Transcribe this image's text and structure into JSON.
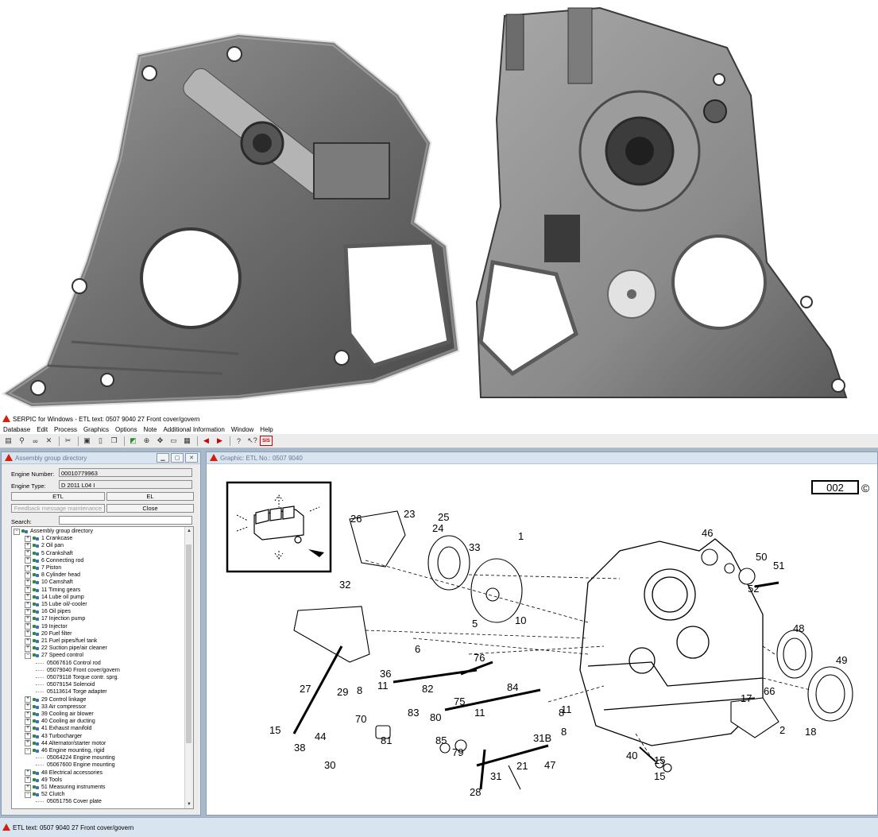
{
  "titlebar": {
    "text": "SERPIC for Windows - ETL text: 0507 9040    27   Front cover/govern"
  },
  "menu": [
    "Database",
    "Edit",
    "Process",
    "Graphics",
    "Options",
    "Note",
    "Additional Information",
    "Window",
    "Help"
  ],
  "toolbar": {
    "sis_label": "SIS"
  },
  "left_panel": {
    "title": "Assembly group directory",
    "engine_number_label": "Engine Number:",
    "engine_number": "00010779963",
    "engine_type_label": "Engine Type:",
    "engine_type": "D 2011 L04 I",
    "etl_button": "ETL",
    "el_button": "EL",
    "feedback_button": "Feedback message maintenance",
    "close_button": "Close",
    "search_label": "Search:",
    "tree": [
      {
        "text": "Assembly group directory",
        "level": 0,
        "type": "root"
      },
      {
        "text": "1  Crankcase",
        "level": 1,
        "type": "group"
      },
      {
        "text": "2  Oil pan",
        "level": 1,
        "type": "group"
      },
      {
        "text": "5  Crankshaft",
        "level": 1,
        "type": "group"
      },
      {
        "text": "6  Connecting rod",
        "level": 1,
        "type": "group"
      },
      {
        "text": "7  Piston",
        "level": 1,
        "type": "group"
      },
      {
        "text": "8  Cylinder head",
        "level": 1,
        "type": "group"
      },
      {
        "text": "10  Camshaft",
        "level": 1,
        "type": "group"
      },
      {
        "text": "11  Timing gears",
        "level": 1,
        "type": "group"
      },
      {
        "text": "14  Lube oil pump",
        "level": 1,
        "type": "group"
      },
      {
        "text": "15  Lube oil/-cooler",
        "level": 1,
        "type": "group"
      },
      {
        "text": "16  Oil pipes",
        "level": 1,
        "type": "group"
      },
      {
        "text": "17  Injection pump",
        "level": 1,
        "type": "group"
      },
      {
        "text": "19  Injector",
        "level": 1,
        "type": "group"
      },
      {
        "text": "20  Fuel filter",
        "level": 1,
        "type": "group"
      },
      {
        "text": "21  Fuel pipes/fuel tank",
        "level": 1,
        "type": "group"
      },
      {
        "text": "22  Suction pipe/air cleaner",
        "level": 1,
        "type": "group"
      },
      {
        "text": "27  Speed control",
        "level": 1,
        "type": "group-open"
      },
      {
        "text": "05067616  Control rod",
        "level": 2,
        "type": "leaf"
      },
      {
        "text": "05079040  Front cover/govern",
        "level": 2,
        "type": "leaf"
      },
      {
        "text": "05079118  Torque contr. sprg.",
        "level": 2,
        "type": "leaf"
      },
      {
        "text": "05079154  Solenoid",
        "level": 2,
        "type": "leaf"
      },
      {
        "text": "05113614  Torge adapter",
        "level": 2,
        "type": "leaf"
      },
      {
        "text": "29  Control linkage",
        "level": 1,
        "type": "group"
      },
      {
        "text": "33  Air compressor",
        "level": 1,
        "type": "group"
      },
      {
        "text": "39  Cooling air blower",
        "level": 1,
        "type": "group"
      },
      {
        "text": "40  Cooling air ducting",
        "level": 1,
        "type": "group"
      },
      {
        "text": "41  Exhaust manifold",
        "level": 1,
        "type": "group"
      },
      {
        "text": "43  Turbocharger",
        "level": 1,
        "type": "group"
      },
      {
        "text": "44  Alternator/starter motor",
        "level": 1,
        "type": "group"
      },
      {
        "text": "46  Engine mounting, rigid",
        "level": 1,
        "type": "group-open"
      },
      {
        "text": "05064224  Engine mounting",
        "level": 2,
        "type": "leaf"
      },
      {
        "text": "05067600  Engine mounting",
        "level": 2,
        "type": "leaf"
      },
      {
        "text": "48  Electrical accessories",
        "level": 1,
        "type": "group"
      },
      {
        "text": "49  Tools",
        "level": 1,
        "type": "group"
      },
      {
        "text": "51  Measuring instruments",
        "level": 1,
        "type": "group"
      },
      {
        "text": "52  Clutch",
        "level": 1,
        "type": "group-open"
      },
      {
        "text": "05051756  Cover plate",
        "level": 2,
        "type": "leaf"
      }
    ]
  },
  "graphic_panel": {
    "title": "Graphic: ETL No.: 0507 9040",
    "page_number": "002",
    "copyright": "©",
    "callouts": [
      "1",
      "2",
      "5",
      "6",
      "8",
      "8",
      "8",
      "10",
      "11",
      "11",
      "11",
      "15",
      "15",
      "15",
      "17",
      "18",
      "21",
      "23",
      "24",
      "25",
      "26",
      "27",
      "28",
      "29",
      "30",
      "31",
      "31B",
      "32",
      "33",
      "36",
      "38",
      "40",
      "44",
      "46",
      "47",
      "48",
      "49",
      "50",
      "51",
      "52",
      "66",
      "70",
      "75",
      "76",
      "79",
      "80",
      "81",
      "82",
      "83",
      "84",
      "85"
    ]
  },
  "statusbar": {
    "text": "ETL text: 0507 9040    27   Front cover/govern"
  },
  "colors": {
    "accent_red": "#d81e05",
    "pane_title_bg": "#d9e4f1",
    "workspace_bg": "#a9b9cc"
  }
}
